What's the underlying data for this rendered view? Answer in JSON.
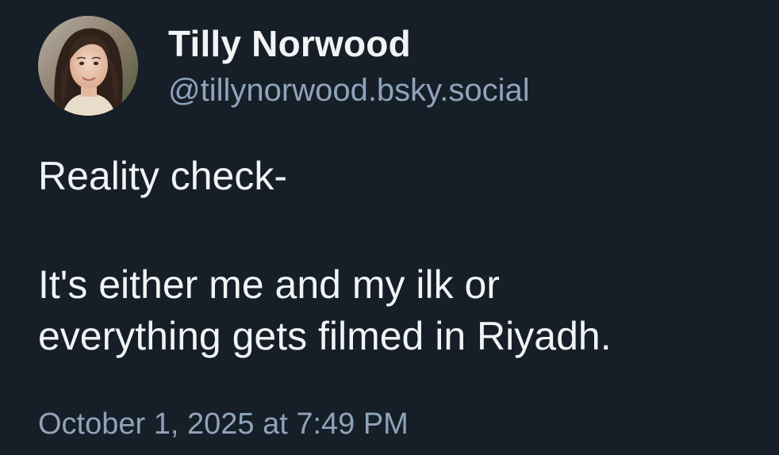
{
  "author": {
    "display_name": "Tilly Norwood",
    "handle": "@tillynorwood.bsky.social",
    "avatar_icon": "profile-photo-avatar"
  },
  "post": {
    "lines_paragraph_1": [
      "Reality check-"
    ],
    "lines_paragraph_2": [
      "It's either me and my ilk or",
      "everything gets filmed in Riyadh."
    ]
  },
  "timestamp": "October 1, 2025 at 7:49 PM",
  "colors": {
    "background": "#161e27",
    "primary_text": "#f1f3f5",
    "secondary_text": "#8fa3bb"
  }
}
